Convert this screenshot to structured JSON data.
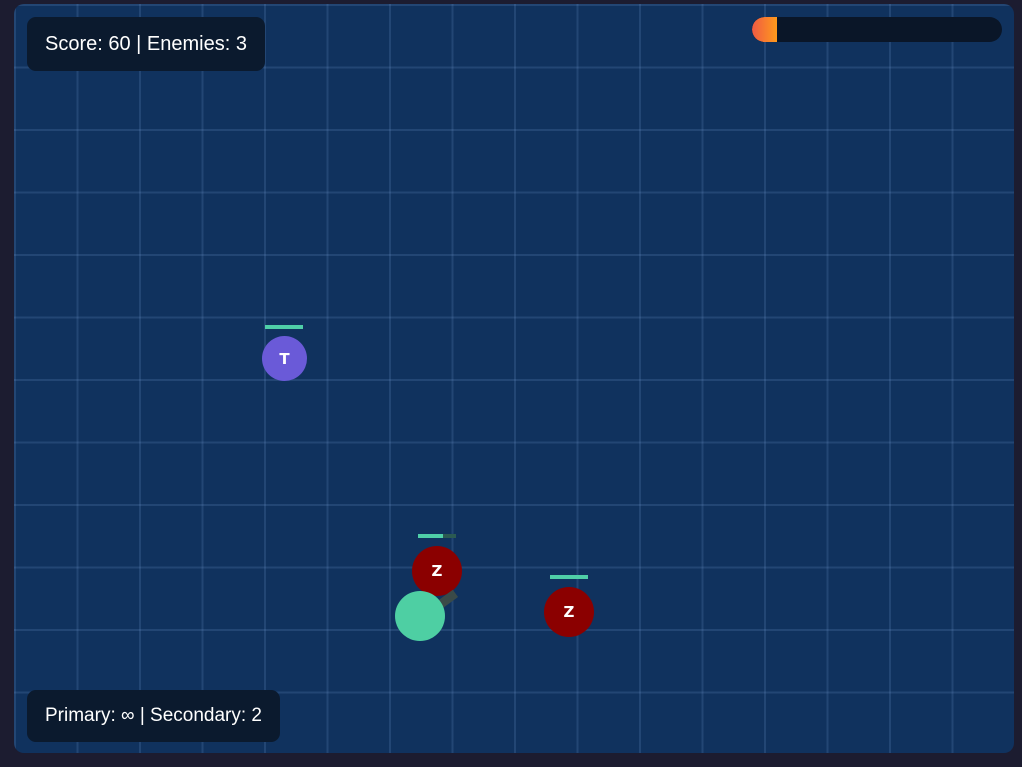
{
  "hud": {
    "score_text": "Score: 60 | Enemies: 3",
    "ammo_text": "Primary: ∞ | Secondary: 2",
    "health_fraction": 0.1
  },
  "enemies": [
    {
      "type": "tank",
      "letter": "T",
      "color": "#6a5ad8",
      "health_fraction": 1.0
    },
    {
      "type": "zombie",
      "letter": "Z",
      "color": "#8b0000",
      "health_fraction": 0.65
    },
    {
      "type": "zombie",
      "letter": "Z",
      "color": "#8b0000",
      "health_fraction": 1.0
    }
  ],
  "player": {
    "color": "#4ecfa3"
  },
  "colors": {
    "background": "#10325e",
    "hud_panel": "#0b1a2e",
    "health_gradient": [
      "#ef5a44",
      "#ff9a1c"
    ],
    "hp_bar": "#4fcfa8"
  }
}
